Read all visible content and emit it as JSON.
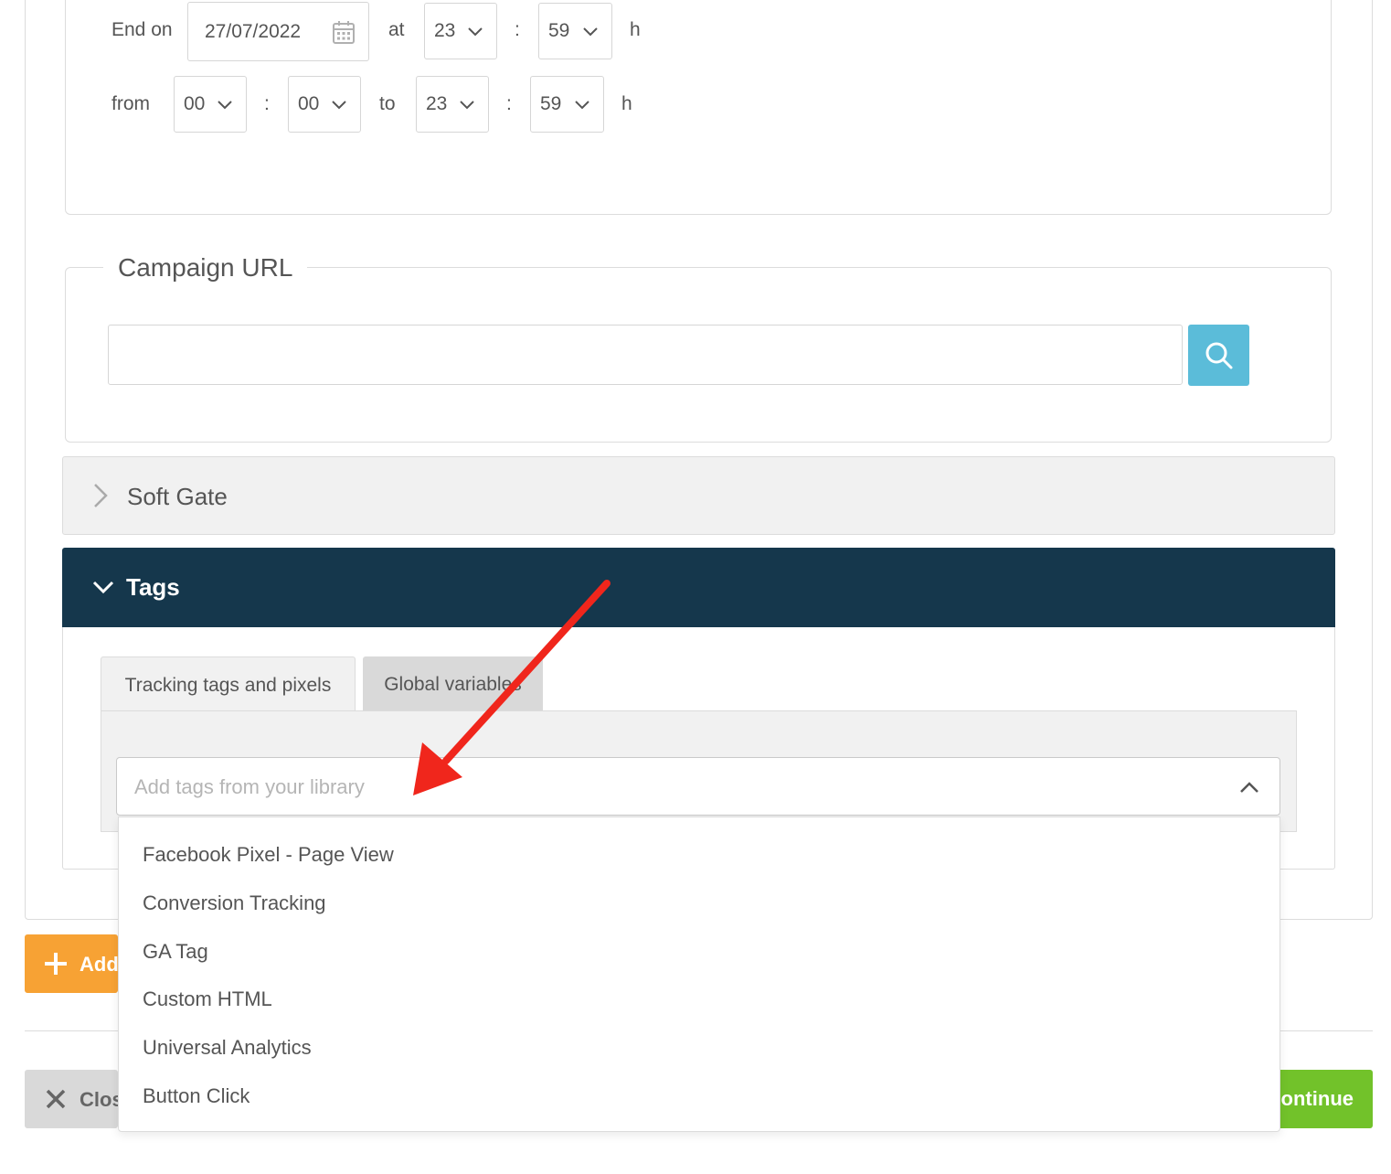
{
  "schedule": {
    "end_label": "End on",
    "end_date": "27/07/2022",
    "at_label": "at",
    "end_hour": "23",
    "colon": ":",
    "end_minute": "59",
    "h_label": "h",
    "from_label": "from",
    "from_hour": "00",
    "from_minute": "00",
    "to_label": "to",
    "to_hour": "23",
    "to_minute": "59"
  },
  "campaign_url": {
    "title": "Campaign URL",
    "value": ""
  },
  "soft_gate": {
    "title": "Soft Gate"
  },
  "tags": {
    "title": "Tags",
    "tabs": [
      {
        "label": "Tracking tags and pixels",
        "active": true
      },
      {
        "label": "Global variables",
        "active": false
      }
    ],
    "select_placeholder": "Add tags from your library",
    "options": [
      "Facebook Pixel - Page View",
      "Conversion Tracking",
      "GA Tag",
      "Custom HTML",
      "Universal Analytics",
      "Button Click"
    ]
  },
  "footer": {
    "add_label": "Add",
    "close_label": "Close",
    "continue_label": "Continue"
  },
  "colors": {
    "accent_blue": "#5bbcd9",
    "tags_header": "#15374c",
    "add_orange": "#f7a234",
    "continue_green": "#72c22a",
    "annotation_red": "#f0261c"
  },
  "icons": {
    "date": "calendar-icon",
    "dropdown": "chevron-down-icon",
    "search": "search-icon",
    "collapsed": "chevron-right-icon",
    "expanded": "chevron-down-icon",
    "open_select": "chevron-up-icon",
    "add": "plus-icon",
    "close": "close-icon",
    "annotation": "red-arrow-annotation"
  }
}
